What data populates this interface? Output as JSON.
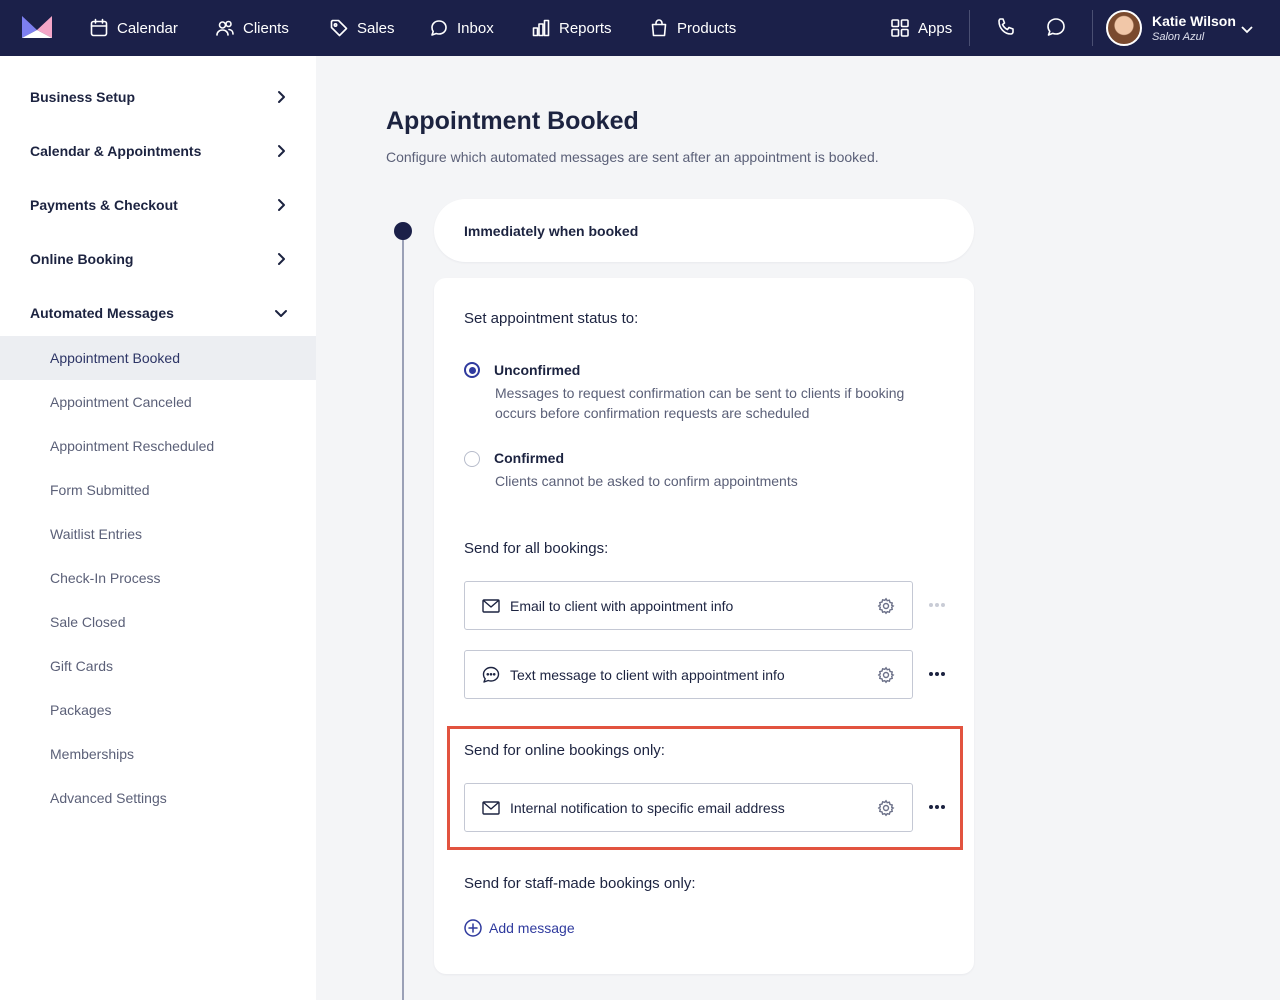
{
  "nav": {
    "items": [
      {
        "label": "Calendar",
        "icon": "calendar-icon"
      },
      {
        "label": "Clients",
        "icon": "clients-icon"
      },
      {
        "label": "Sales",
        "icon": "tag-icon"
      },
      {
        "label": "Inbox",
        "icon": "inbox-icon"
      },
      {
        "label": "Reports",
        "icon": "reports-icon"
      },
      {
        "label": "Products",
        "icon": "bag-icon"
      }
    ],
    "apps_label": "Apps",
    "user": {
      "name": "Katie Wilson",
      "org": "Salon Azul"
    }
  },
  "sidebar": {
    "sections": [
      {
        "label": "Business Setup",
        "expanded": false
      },
      {
        "label": "Calendar & Appointments",
        "expanded": false
      },
      {
        "label": "Payments & Checkout",
        "expanded": false
      },
      {
        "label": "Online Booking",
        "expanded": false
      },
      {
        "label": "Automated Messages",
        "expanded": true
      }
    ],
    "sub_items": [
      {
        "label": "Appointment Booked",
        "active": true
      },
      {
        "label": "Appointment Canceled"
      },
      {
        "label": "Appointment Rescheduled"
      },
      {
        "label": "Form Submitted"
      },
      {
        "label": "Waitlist Entries"
      },
      {
        "label": "Check-In Process"
      },
      {
        "label": "Sale Closed"
      },
      {
        "label": "Gift Cards"
      },
      {
        "label": "Packages"
      },
      {
        "label": "Memberships"
      },
      {
        "label": "Advanced Settings"
      }
    ]
  },
  "main": {
    "title": "Appointment Booked",
    "description": "Configure which automated messages are sent after an appointment is booked.",
    "trigger": "Immediately when booked",
    "status_heading": "Set appointment status to:",
    "status_options": [
      {
        "label": "Unconfirmed",
        "checked": true,
        "desc": "Messages to request confirmation can be sent to clients if booking occurs before confirmation requests are scheduled"
      },
      {
        "label": "Confirmed",
        "checked": false,
        "desc": "Clients cannot be asked to confirm appointments"
      }
    ],
    "all_bookings_heading": "Send for all bookings:",
    "all_bookings_messages": [
      {
        "label": "Email to client with appointment info",
        "icon": "mail-icon"
      },
      {
        "label": "Text message to client with appointment info",
        "icon": "chat-icon"
      }
    ],
    "online_heading": "Send for online bookings only:",
    "online_messages": [
      {
        "label": "Internal notification to specific email address",
        "icon": "mail-icon"
      }
    ],
    "staff_heading": "Send for staff-made bookings only:",
    "add_message_label": "Add message"
  },
  "colors": {
    "nav_bg": "#1b2049",
    "accent": "#2f3a9e",
    "highlight": "#e2533f"
  }
}
